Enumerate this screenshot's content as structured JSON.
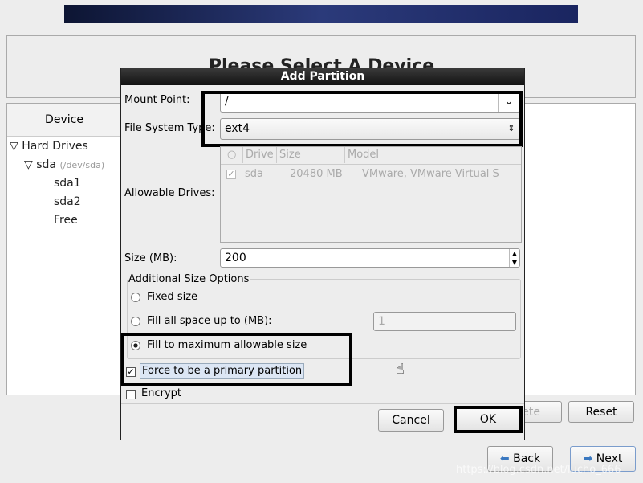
{
  "background": {
    "title": "Please Select A Device",
    "device_header": "Device",
    "tree": {
      "hard_drives": "Hard Drives",
      "sda": "sda",
      "sda_path": "(/dev/sda)",
      "sda1": "sda1",
      "sda2": "sda2",
      "free": "Free"
    },
    "delete_label": "Delete",
    "reset_label": "Reset",
    "back_label": "Back",
    "next_label": "Next"
  },
  "dialog": {
    "title": "Add Partition",
    "mount_point_label": "Mount Point:",
    "mount_point_value": "/",
    "fs_type_label": "File System Type:",
    "fs_type_value": "ext4",
    "allowable_drives_label": "Allowable Drives:",
    "drives_columns": [
      "Drive",
      "Size",
      "Model"
    ],
    "drives_rows": [
      {
        "drive": "sda",
        "size": "20480 MB",
        "model": "VMware, VMware Virtual S",
        "checked": true
      }
    ],
    "size_label": "Size (MB):",
    "size_value": "200",
    "additional_size_label": "Additional Size Options",
    "fixed_size": "Fixed size",
    "fill_up_to": "Fill all space up to (MB):",
    "fill_up_to_value": "1",
    "fill_max": "Fill to maximum allowable size",
    "selected_size_option": "fill_max",
    "force_primary": "Force to be a primary partition",
    "force_primary_checked": true,
    "encrypt": "Encrypt",
    "encrypt_checked": false,
    "cancel_label": "Cancel",
    "ok_label": "OK"
  },
  "watermark": "https://blog.csdn.net/lucho_666"
}
